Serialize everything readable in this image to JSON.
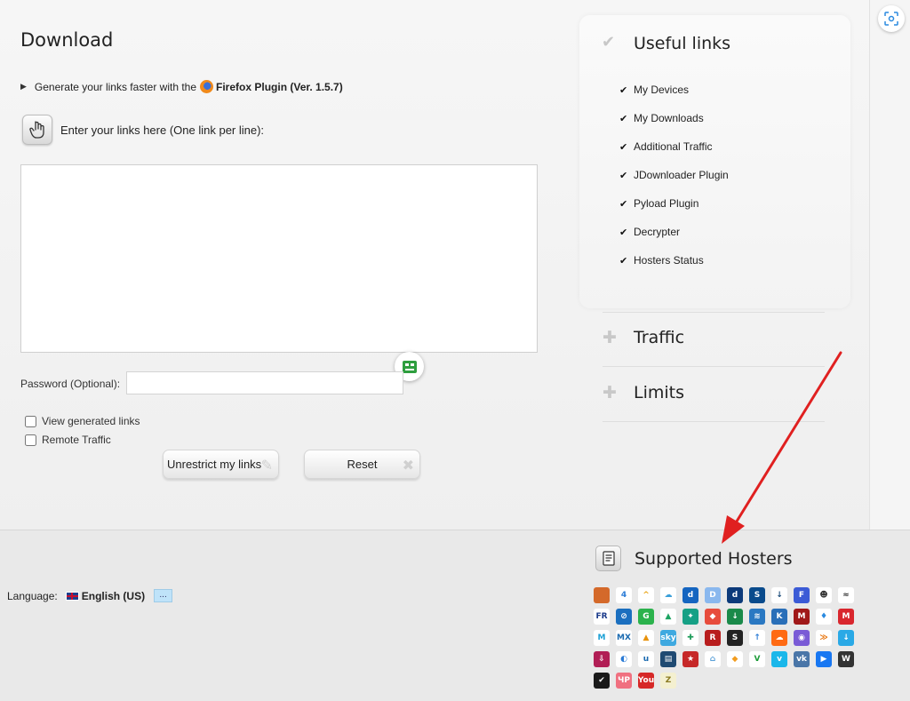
{
  "page": {
    "title": "Download",
    "plugin_text": "Generate your links faster with the",
    "plugin_name": "Firefox Plugin (Ver. 1.5.7)",
    "enter_links_label": "Enter your links here (One link per line):",
    "links_value": "",
    "password_label": "Password (Optional):",
    "password_value": "",
    "checkbox_view_generated": "View generated links",
    "checkbox_remote_traffic": "Remote Traffic",
    "unrestrict_button": "Unrestrict my links",
    "reset_button": "Reset"
  },
  "useful_links": {
    "title": "Useful links",
    "items": [
      "My Devices",
      "My Downloads",
      "Additional Traffic",
      "JDownloader Plugin",
      "Pyload Plugin",
      "Decrypter",
      "Hosters Status"
    ]
  },
  "accordion": {
    "traffic": "Traffic",
    "limits": "Limits"
  },
  "footer": {
    "language_label": "Language:",
    "language_value": "English (US)",
    "more_button": "...",
    "hosters_title": "Supported Hosters"
  },
  "hosters": [
    {
      "name": "1fichier",
      "glyph": "",
      "color": "#d4692a"
    },
    {
      "name": "4shared",
      "glyph": "4",
      "color": "#ffffff",
      "fg": "#2a7bd6"
    },
    {
      "name": "alfafile",
      "glyph": "^",
      "color": "#ffffff",
      "fg": "#e8a413"
    },
    {
      "name": "cloud",
      "glyph": "☁",
      "color": "#ffffff",
      "fg": "#3a9fd9"
    },
    {
      "name": "ddownload",
      "glyph": "d",
      "color": "#1565c0"
    },
    {
      "name": "dropapk",
      "glyph": "D",
      "color": "#8ab8ee"
    },
    {
      "name": "drop",
      "glyph": "d",
      "color": "#0c3a7a"
    },
    {
      "name": "dl",
      "glyph": "S",
      "color": "#0a4b8c"
    },
    {
      "name": "download",
      "glyph": "↓",
      "color": "#ffffff",
      "fg": "#1a4a78"
    },
    {
      "name": "filefactory",
      "glyph": "F",
      "color": "#3b5bd6"
    },
    {
      "name": "spy",
      "glyph": "☻",
      "color": "#ffffff",
      "fg": "#333"
    },
    {
      "name": "fileal",
      "glyph": "≈",
      "color": "#ffffff",
      "fg": "#333"
    },
    {
      "name": "fr",
      "glyph": "FR",
      "color": "#ffffff",
      "fg": "#1a3a8a"
    },
    {
      "name": "gigapeta",
      "glyph": "⊘",
      "color": "#1b6fbf"
    },
    {
      "name": "google",
      "glyph": "G",
      "color": "#2bb24c"
    },
    {
      "name": "gdrive",
      "glyph": "▲",
      "color": "#ffffff",
      "fg": "#1da462"
    },
    {
      "name": "hexload",
      "glyph": "✦",
      "color": "#16a085"
    },
    {
      "name": "hitfile",
      "glyph": "◆",
      "color": "#e74c3c"
    },
    {
      "name": "hotlink",
      "glyph": "↓",
      "color": "#1a8a4a"
    },
    {
      "name": "isra",
      "glyph": "≋",
      "color": "#2a78c2"
    },
    {
      "name": "katfile",
      "glyph": "K",
      "color": "#2a6fb8"
    },
    {
      "name": "mediafire",
      "glyph": "M",
      "color": "#a01919"
    },
    {
      "name": "fire",
      "glyph": "♦",
      "color": "#ffffff",
      "fg": "#2a8ae0"
    },
    {
      "name": "mega",
      "glyph": "M",
      "color": "#d9272e"
    },
    {
      "name": "mixdrop",
      "glyph": "M",
      "color": "#ffffff",
      "fg": "#1da1d6"
    },
    {
      "name": "mx",
      "glyph": "MX",
      "color": "#ffffff",
      "fg": "#1a6ab0"
    },
    {
      "name": "nitro",
      "glyph": "▲",
      "color": "#ffffff",
      "fg": "#e8920c"
    },
    {
      "name": "oboom",
      "glyph": "sky",
      "color": "#3fa9e0"
    },
    {
      "name": "prefiles",
      "glyph": "✚",
      "color": "#ffffff",
      "fg": "#1e9c5a"
    },
    {
      "name": "rapidgator",
      "glyph": "R",
      "color": "#b81d1d"
    },
    {
      "name": "scribd",
      "glyph": "S",
      "color": "#222222"
    },
    {
      "name": "up",
      "glyph": "↑",
      "color": "#ffffff",
      "fg": "#2a7bd6"
    },
    {
      "name": "soundcloud",
      "glyph": "☁",
      "color": "#ff6a13"
    },
    {
      "name": "turbo",
      "glyph": "◉",
      "color": "#7a5bd6"
    },
    {
      "name": "layers",
      "glyph": "≫",
      "color": "#ffffff",
      "fg": "#e8740c"
    },
    {
      "name": "uptobox",
      "glyph": "↓",
      "color": "#2aa9e6"
    },
    {
      "name": "uploaded",
      "glyph": "⇩",
      "color": "#b11e55"
    },
    {
      "name": "uploadrar",
      "glyph": "◐",
      "color": "#ffffff",
      "fg": "#2a7bd6"
    },
    {
      "name": "usersdrive",
      "glyph": "u",
      "color": "#ffffff",
      "fg": "#1a6ab0"
    },
    {
      "name": "vidoza",
      "glyph": "▤",
      "color": "#1f4a72"
    },
    {
      "name": "star",
      "glyph": "★",
      "color": "#c62828"
    },
    {
      "name": "home",
      "glyph": "⌂",
      "color": "#ffffff",
      "fg": "#5aa0d8"
    },
    {
      "name": "diamond",
      "glyph": "◆",
      "color": "#ffffff",
      "fg": "#f29c1f"
    },
    {
      "name": "v",
      "glyph": "V",
      "color": "#ffffff",
      "fg": "#1e9c3a"
    },
    {
      "name": "vimeo",
      "glyph": "v",
      "color": "#1ab7ea"
    },
    {
      "name": "vk",
      "glyph": "vk",
      "color": "#4a76a8"
    },
    {
      "name": "play",
      "glyph": "▶",
      "color": "#1877f2"
    },
    {
      "name": "w",
      "glyph": "W",
      "color": "#333333"
    },
    {
      "name": "check",
      "glyph": "✔",
      "color": "#1a1a1a"
    },
    {
      "name": "yp",
      "glyph": "ЧР",
      "color": "#f07080"
    },
    {
      "name": "youtube",
      "glyph": "You",
      "color": "#d62828"
    },
    {
      "name": "zip",
      "glyph": "Z",
      "color": "#f4f0d0",
      "fg": "#8a7a20"
    }
  ]
}
